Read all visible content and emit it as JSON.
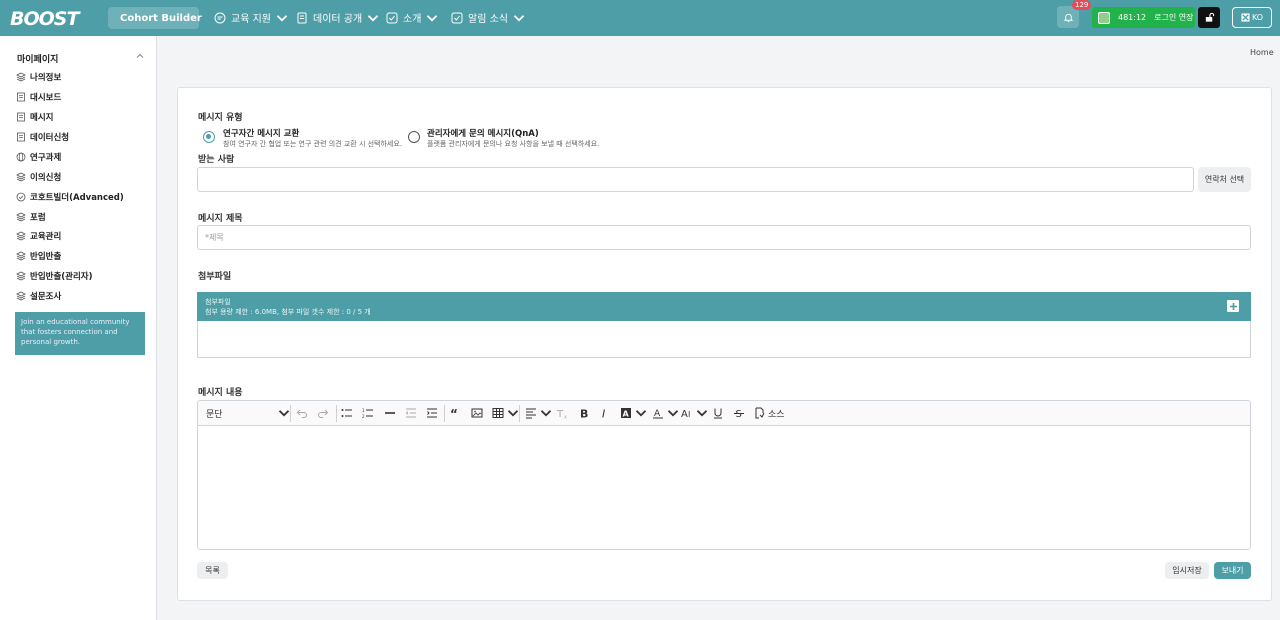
{
  "header": {
    "logo": "BOOST",
    "cohort_builder": "Cohort Builder",
    "nav": [
      {
        "label": "교육 지원"
      },
      {
        "label": "데이터 공개"
      },
      {
        "label": "소개"
      },
      {
        "label": "알림 소식"
      }
    ],
    "notification_count": "129",
    "session_time": "481:12",
    "session_extend": "로그인 연장",
    "language": "KO"
  },
  "sidebar": {
    "title": "마이페이지",
    "items": [
      {
        "label": "나의정보",
        "icon": "layers-icon"
      },
      {
        "label": "대시보드",
        "icon": "document-icon"
      },
      {
        "label": "메시지",
        "icon": "document-icon"
      },
      {
        "label": "데이터신청",
        "icon": "document-icon"
      },
      {
        "label": "연구과제",
        "icon": "globe-icon"
      },
      {
        "label": "이의신청",
        "icon": "layers-icon"
      },
      {
        "label": "코호트빌더(Advanced)",
        "icon": "check-circle-icon"
      },
      {
        "label": "포럼",
        "icon": "layers-icon"
      },
      {
        "label": "교육관리",
        "icon": "layers-icon"
      },
      {
        "label": "반입반출",
        "icon": "layers-icon"
      },
      {
        "label": "반입반출(관리자)",
        "icon": "layers-icon"
      },
      {
        "label": "설문조사",
        "icon": "layers-icon"
      }
    ],
    "banner": "Join an educational community that fosters connection and personal growth."
  },
  "breadcrumb": "Home",
  "form": {
    "message_type_label": "메시지 유형",
    "options": [
      {
        "title": "연구자간 메시지 교환",
        "desc": "참여 연구자 간 협업 또는 연구 관련 의견 교환 시 선택하세요.",
        "checked": true
      },
      {
        "title": "관리자에게 문의 메시지(QnA)",
        "desc": "플랫폼 관리자에게 문의나 요청 사항을 보낼 때 선택하세요.",
        "checked": false
      }
    ],
    "recipient_label": "받는 사람",
    "recipient_value": "",
    "contact_select": "연락처 선택",
    "subject_label": "메시지 제목",
    "subject_placeholder": "*제목",
    "attachment_label": "첨부파일",
    "attachment_header_title": "첨부파일",
    "attachment_limit": "첨부 용량 제한 : 6.0MB, 첨부 파일 갯수 제한 : 0 / 5 개",
    "content_label": "메시지 내용",
    "paragraph_select": "문단",
    "source_label": "소스",
    "list_button": "목록",
    "draft_button": "임시저장",
    "send_button": "보내기"
  },
  "colors": {
    "primary": "#4d9ea6",
    "session_green": "#22b24c",
    "badge_red": "#e54b5b"
  }
}
